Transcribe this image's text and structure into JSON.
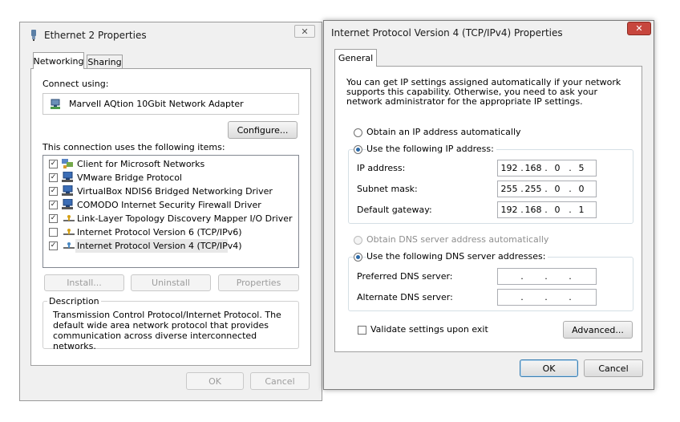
{
  "eth_dialog": {
    "title": "Ethernet 2 Properties",
    "close_glyph": "✕",
    "tabs": [
      {
        "label": "Networking",
        "active": true
      },
      {
        "label": "Sharing",
        "active": false
      }
    ],
    "connect_using_label": "Connect using:",
    "adapter_name": "Marvell AQtion 10Gbit Network Adapter",
    "configure_label": "Configure...",
    "items_label": "This connection uses the following items:",
    "items": [
      {
        "label": "Client for Microsoft Networks",
        "checked": true,
        "icon": "client-icon"
      },
      {
        "label": "VMware Bridge Protocol",
        "checked": true,
        "icon": "network-service-icon"
      },
      {
        "label": "VirtualBox NDIS6 Bridged Networking Driver",
        "checked": true,
        "icon": "network-service-icon"
      },
      {
        "label": "COMODO Internet Security Firewall Driver",
        "checked": true,
        "icon": "network-service-icon"
      },
      {
        "label": "Link-Layer Topology Discovery Mapper I/O Driver",
        "checked": true,
        "icon": "protocol-icon"
      },
      {
        "label": "Internet Protocol Version 6 (TCP/IPv6)",
        "checked": false,
        "icon": "protocol-icon"
      },
      {
        "label": "Internet Protocol Version 4 (TCP/IPv4)",
        "checked": true,
        "icon": "protocol-icon"
      }
    ],
    "install_label": "Install...",
    "uninstall_label": "Uninstall",
    "properties_label": "Properties",
    "description_heading": "Description",
    "description_text": "Transmission Control Protocol/Internet Protocol. The default wide area network protocol that provides communication across diverse interconnected networks.",
    "ok_label": "OK",
    "cancel_label": "Cancel"
  },
  "ipv4_dialog": {
    "title": "Internet Protocol Version 4 (TCP/IPv4) Properties",
    "close_glyph": "✕",
    "tab_label": "General",
    "intro_text": "You can get IP settings assigned automatically if your network supports this capability. Otherwise, you need to ask your network administrator for the appropriate IP settings.",
    "obtain_ip_label": "Obtain an IP address automatically",
    "use_ip_label": "Use the following IP address:",
    "ip_address_label": "IP address:",
    "ip_address": [
      "192",
      "168",
      "0",
      "5"
    ],
    "subnet_label": "Subnet mask:",
    "subnet": [
      "255",
      "255",
      "0",
      "0"
    ],
    "gateway_label": "Default gateway:",
    "gateway": [
      "192",
      "168",
      "0",
      "1"
    ],
    "obtain_dns_label": "Obtain DNS server address automatically",
    "use_dns_label": "Use the following DNS server addresses:",
    "preferred_dns_label": "Preferred DNS server:",
    "preferred_dns": [
      "",
      "",
      "",
      ""
    ],
    "alternate_dns_label": "Alternate DNS server:",
    "alternate_dns": [
      "",
      "",
      "",
      ""
    ],
    "validate_label": "Validate settings upon exit",
    "validate_checked": false,
    "advanced_label": "Advanced...",
    "ok_label": "OK",
    "cancel_label": "Cancel",
    "ip_mode": "manual",
    "dns_mode": "manual"
  },
  "colors": {
    "close_red": "#c7463d",
    "selection": "#e8e8e8"
  }
}
